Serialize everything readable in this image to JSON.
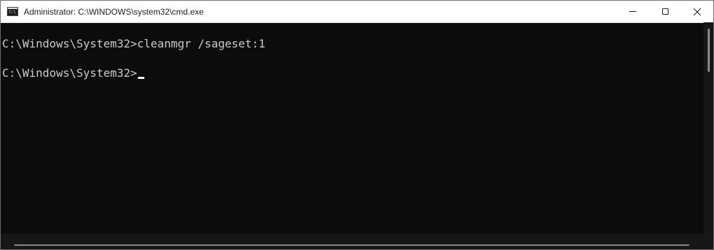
{
  "window": {
    "title": "Administrator: C:\\WINDOWS\\system32\\cmd.exe",
    "icon": "cmd-icon",
    "icon_text": "C:\\",
    "controls": {
      "minimize_icon": "minimize-icon",
      "maximize_icon": "maximize-icon",
      "close_icon": "close-icon"
    }
  },
  "console": {
    "lines": [
      "C:\\Windows\\System32>cleanmgr /sageset:1",
      "",
      "C:\\Windows\\System32>"
    ],
    "text_color": "#cccccc",
    "background_color": "#0c0c0c"
  }
}
